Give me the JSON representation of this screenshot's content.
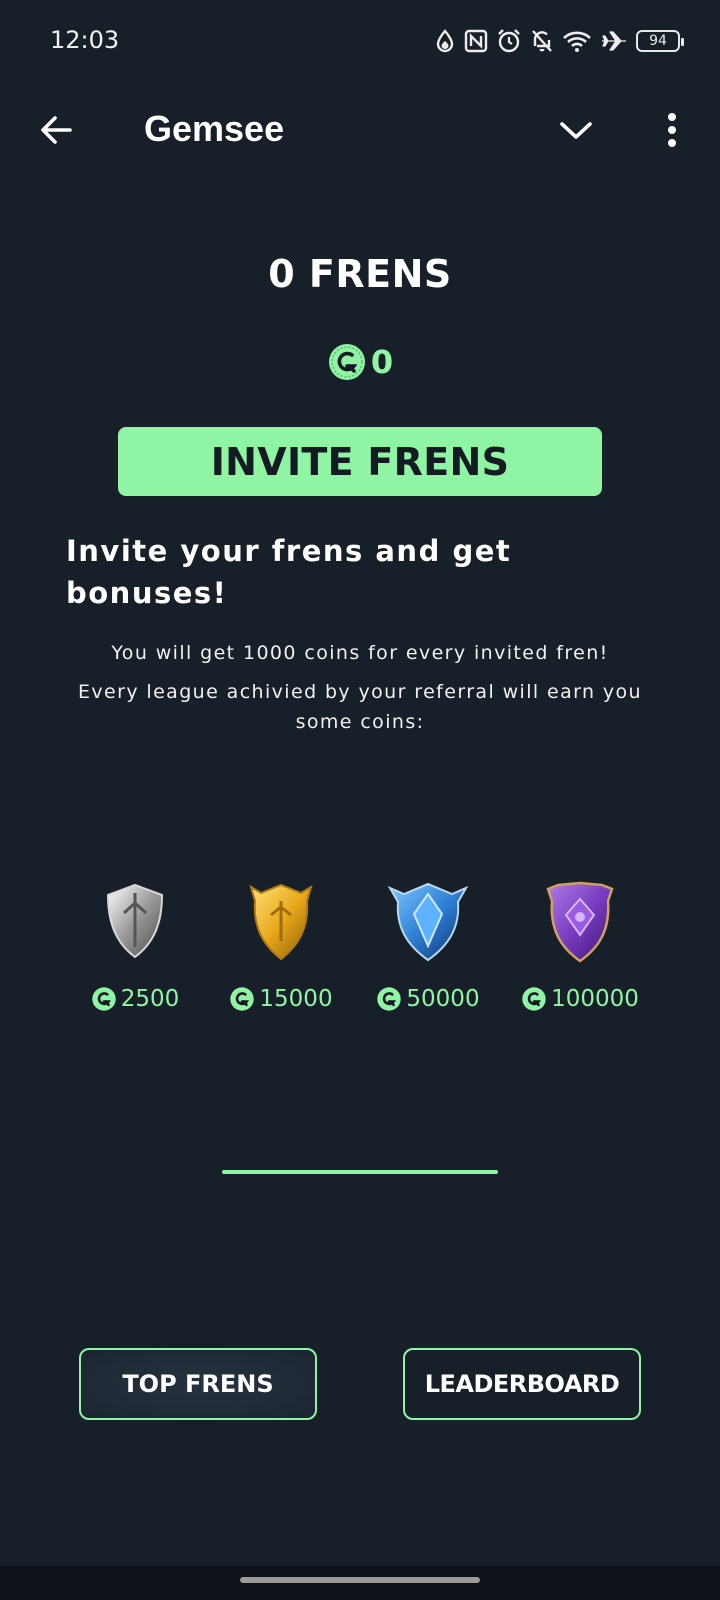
{
  "status_bar": {
    "time": "12:03",
    "battery": "94",
    "icons": [
      "data-saver-icon",
      "nfc-icon",
      "alarm-icon",
      "bell-off-icon",
      "wifi-icon",
      "airplane-icon",
      "battery-icon"
    ]
  },
  "app_bar": {
    "title": "Gemsee",
    "back_icon": "arrow-left-icon",
    "dropdown_icon": "chevron-down-icon",
    "menu_icon": "more-vertical-icon"
  },
  "summary": {
    "frens_count": "0 FRENS",
    "coins": "0"
  },
  "invite_button": "INVITE FRENS",
  "invite_heading": "Invite your frens and get bonuses!",
  "info": {
    "line1": "You will get 1000 coins for every invited fren!",
    "line2": "Every league achivied by your referral will earn you some coins:"
  },
  "leagues": [
    {
      "icon": "silver-shield-icon",
      "reward": "2500",
      "color": "#c8c8c8"
    },
    {
      "icon": "gold-shield-icon",
      "reward": "15000",
      "color": "#e8a81c"
    },
    {
      "icon": "blue-shield-icon",
      "reward": "50000",
      "color": "#2e7fd6"
    },
    {
      "icon": "purple-shield-icon",
      "reward": "100000",
      "color": "#7a3cc0"
    }
  ],
  "buttons": {
    "top_frens": "TOP FRENS",
    "leaderboard": "LEADERBOARD"
  },
  "colors": {
    "background": "#171f29",
    "accent": "#8ff5a4"
  }
}
